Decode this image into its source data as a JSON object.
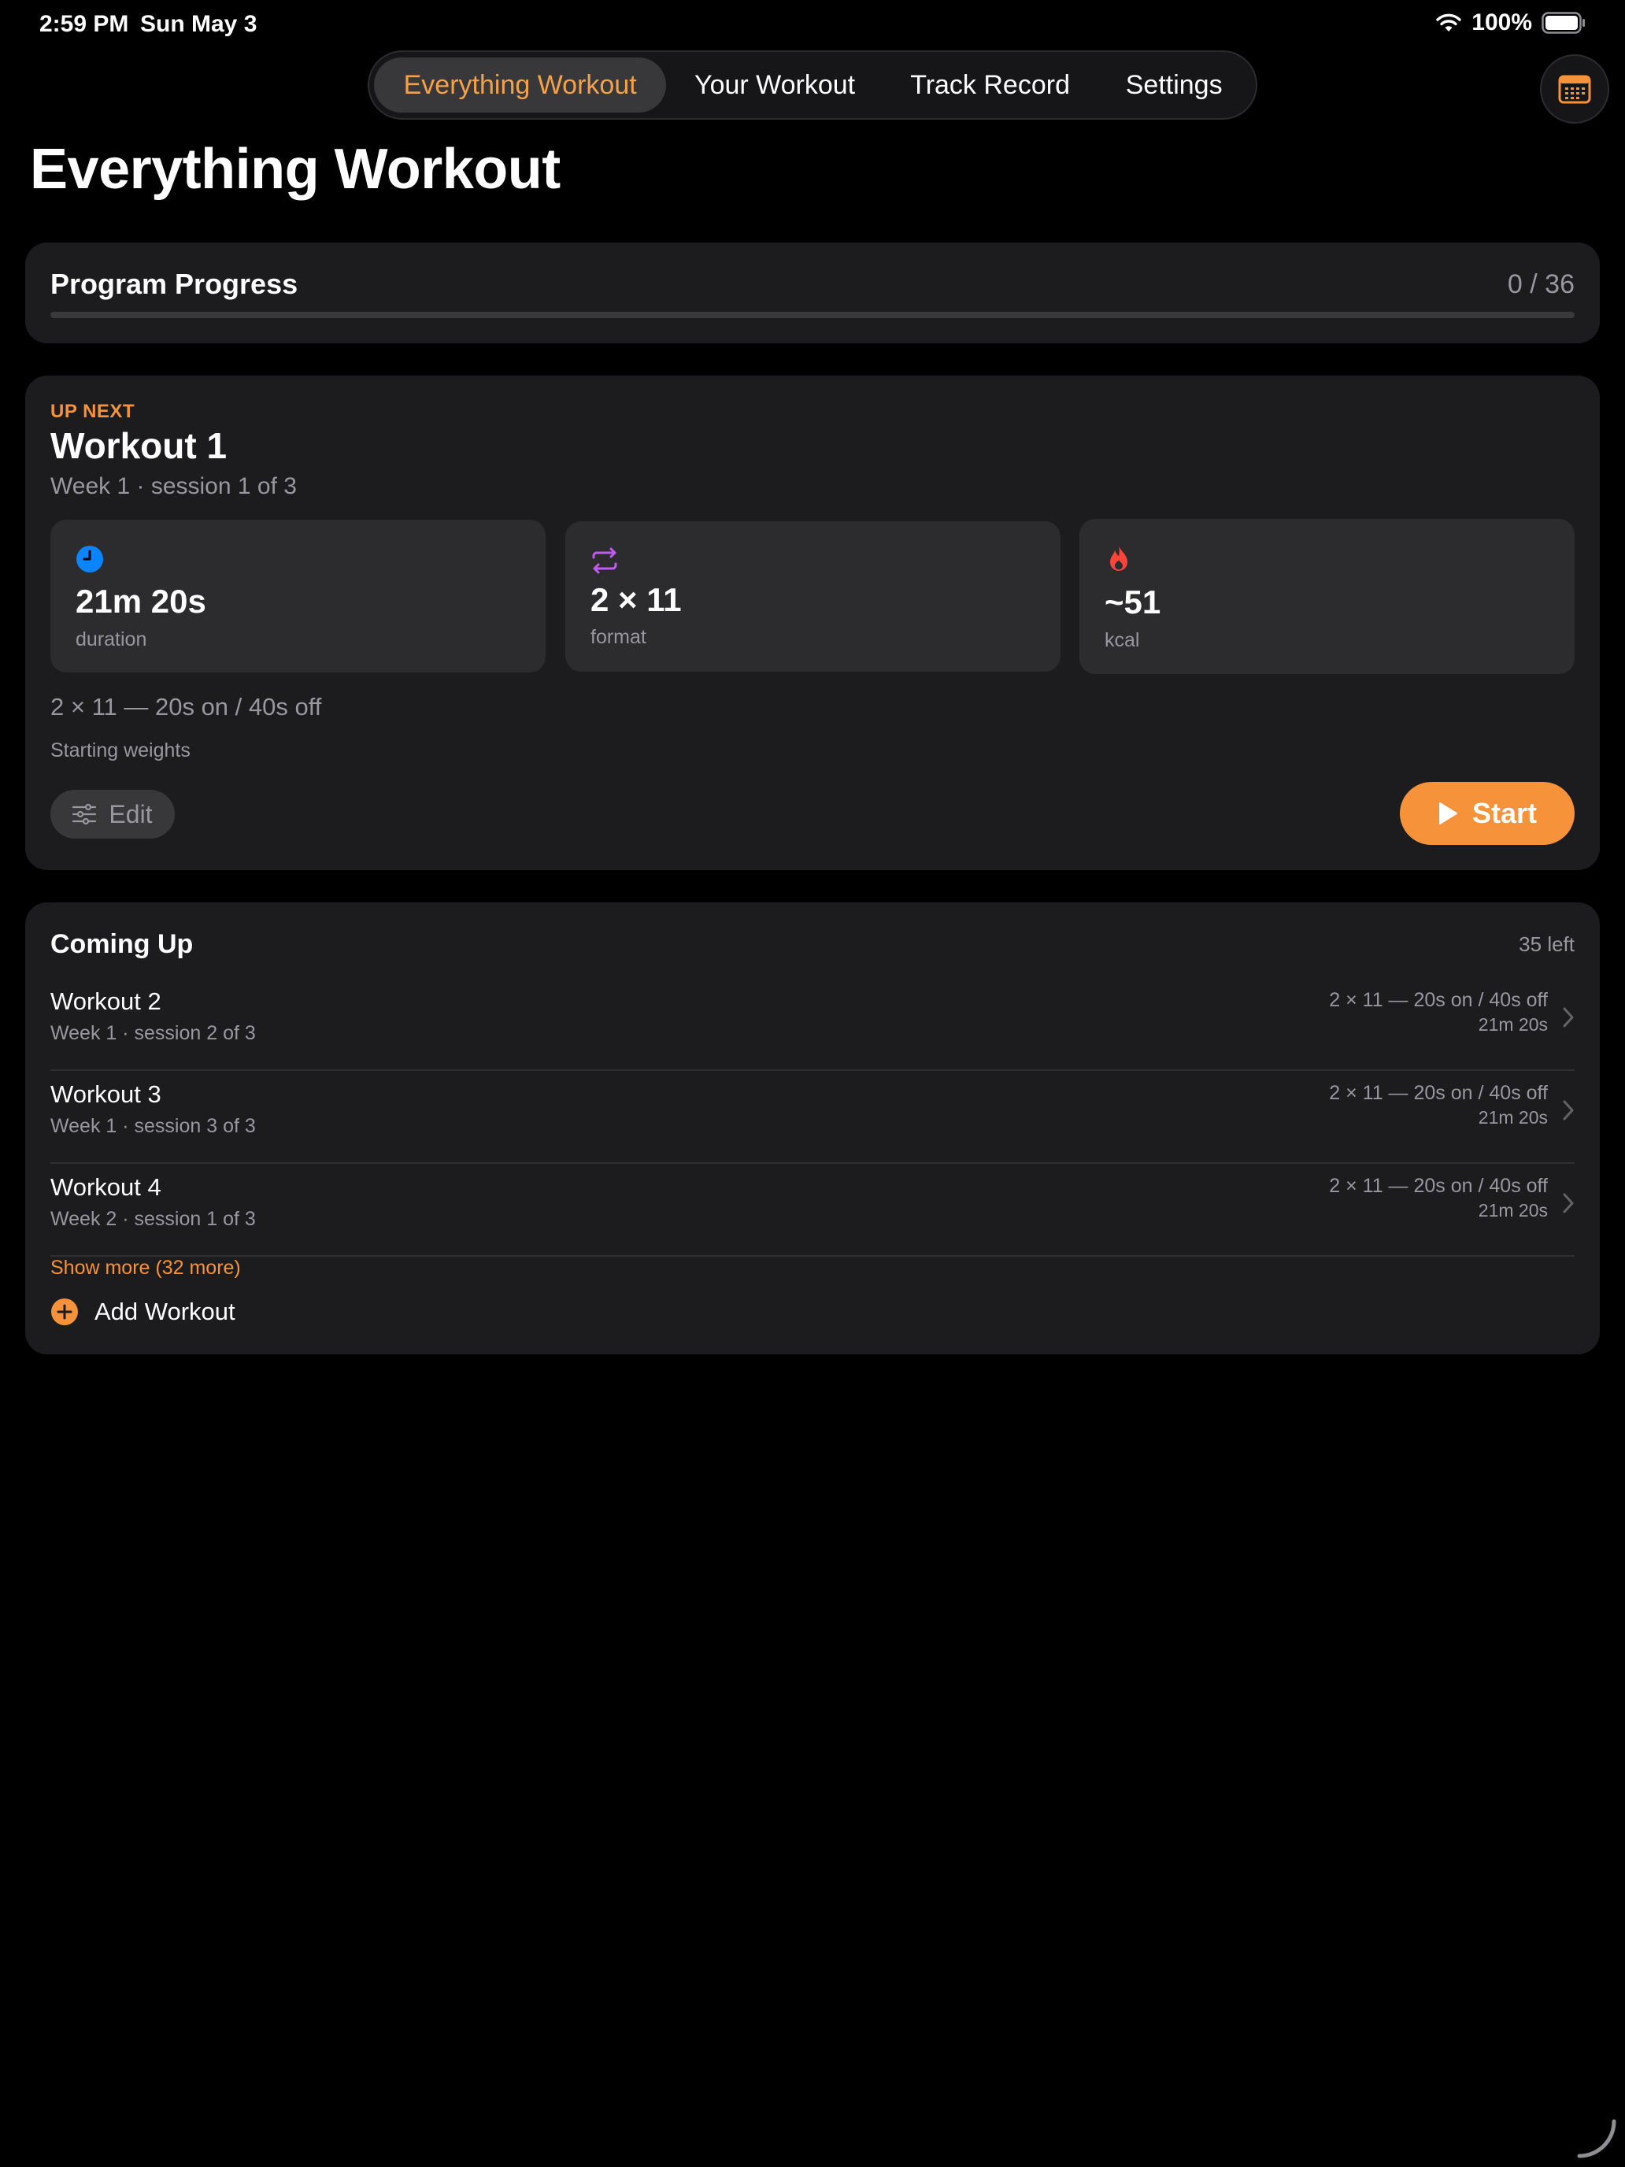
{
  "status_bar": {
    "time": "2:59 PM",
    "date": "Sun May 3",
    "battery": "100%"
  },
  "tabs": [
    {
      "label": "Everything Workout",
      "active": true
    },
    {
      "label": "Your Workout",
      "active": false
    },
    {
      "label": "Track Record",
      "active": false
    },
    {
      "label": "Settings",
      "active": false
    }
  ],
  "page_title": "Everything Workout",
  "progress": {
    "label": "Program Progress",
    "count": "0 / 36",
    "completed": 0,
    "total": 36
  },
  "up_next": {
    "kicker": "UP NEXT",
    "title": "Workout 1",
    "subtitle": "Week 1 · session 1 of 3",
    "stats": [
      {
        "icon": "clock-icon",
        "value": "21m 20s",
        "label": "duration",
        "color": "#0a84ff"
      },
      {
        "icon": "repeat-icon",
        "value": "2 × 11",
        "label": "format",
        "color": "#bf5af2"
      },
      {
        "icon": "flame-icon",
        "value": "~51",
        "label": "kcal",
        "color": "#ff453a"
      }
    ],
    "format_text": "2 × 11 — 20s on / 40s off",
    "weights_text": "Starting weights",
    "edit_label": "Edit",
    "start_label": "Start"
  },
  "coming_up": {
    "title": "Coming Up",
    "left": "35 left",
    "items": [
      {
        "name": "Workout 2",
        "sub": "Week 1 · session 2 of 3",
        "format": "2 × 11 — 20s on / 40s off",
        "duration": "21m 20s"
      },
      {
        "name": "Workout 3",
        "sub": "Week 1 · session 3 of 3",
        "format": "2 × 11 — 20s on / 40s off",
        "duration": "21m 20s"
      },
      {
        "name": "Workout 4",
        "sub": "Week 2 · session 1 of 3",
        "format": "2 × 11 — 20s on / 40s off",
        "duration": "21m 20s"
      }
    ],
    "show_more": "Show more (32 more)",
    "add_label": "Add Workout"
  },
  "colors": {
    "accent": "#f5923a",
    "background": "#000000",
    "card": "#1c1c1e"
  }
}
